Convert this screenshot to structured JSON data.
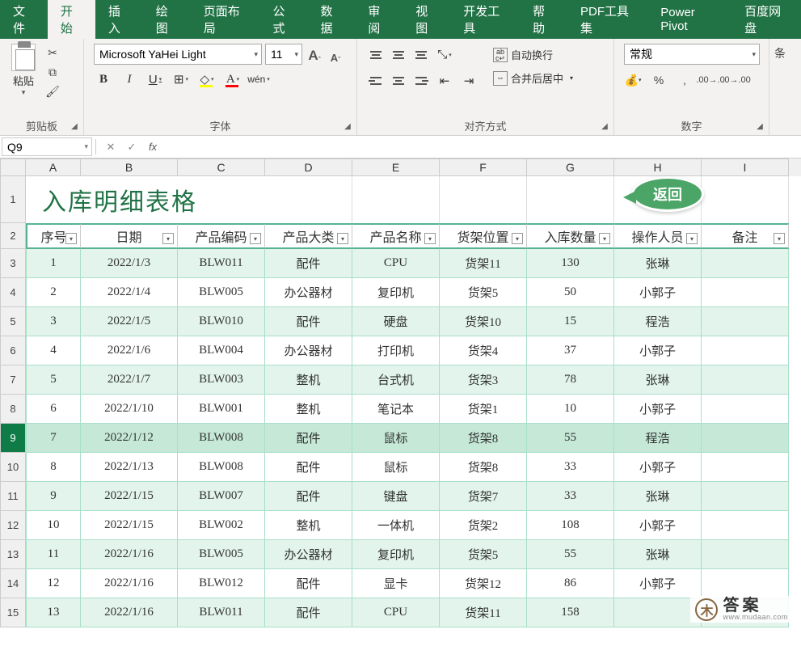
{
  "ribbon": {
    "tabs": [
      "文件",
      "开始",
      "插入",
      "绘图",
      "页面布局",
      "公式",
      "数据",
      "审阅",
      "视图",
      "开发工具",
      "帮助",
      "PDF工具集",
      "Power Pivot",
      "百度网盘"
    ],
    "active_tab": 1,
    "clipboard": {
      "paste": "粘贴",
      "label": "剪贴板"
    },
    "font": {
      "label": "字体",
      "name": "Microsoft YaHei Light",
      "size": "11",
      "increase": "A",
      "decrease": "A",
      "bold": "B",
      "italic": "I",
      "underline": "U",
      "wen": "wén"
    },
    "alignment": {
      "label": "对齐方式",
      "wrap": "自动换行",
      "merge": "合并后居中"
    },
    "number": {
      "label": "数字",
      "format": "常规",
      "percent": "%",
      "comma": ","
    },
    "edge": "条"
  },
  "namebox": "Q9",
  "formula": "",
  "columns": [
    "A",
    "B",
    "C",
    "D",
    "E",
    "F",
    "G",
    "H",
    "I"
  ],
  "row_numbers": [
    1,
    2,
    3,
    4,
    5,
    6,
    7,
    8,
    9,
    10,
    11,
    12,
    13,
    14,
    15
  ],
  "selected_row": 9,
  "title": "入库明细表格",
  "return_button": "返回",
  "headers": [
    "序号",
    "日期",
    "产品编码",
    "产品大类",
    "产品名称",
    "货架位置",
    "入库数量",
    "操作人员",
    "备注"
  ],
  "rows": [
    {
      "n": "1",
      "date": "2022/1/3",
      "code": "BLW011",
      "cat": "配件",
      "name": "CPU",
      "shelf": "货架11",
      "qty": "130",
      "op": "张琳",
      "note": ""
    },
    {
      "n": "2",
      "date": "2022/1/4",
      "code": "BLW005",
      "cat": "办公器材",
      "name": "复印机",
      "shelf": "货架5",
      "qty": "50",
      "op": "小郭子",
      "note": ""
    },
    {
      "n": "3",
      "date": "2022/1/5",
      "code": "BLW010",
      "cat": "配件",
      "name": "硬盘",
      "shelf": "货架10",
      "qty": "15",
      "op": "程浩",
      "note": ""
    },
    {
      "n": "4",
      "date": "2022/1/6",
      "code": "BLW004",
      "cat": "办公器材",
      "name": "打印机",
      "shelf": "货架4",
      "qty": "37",
      "op": "小郭子",
      "note": ""
    },
    {
      "n": "5",
      "date": "2022/1/7",
      "code": "BLW003",
      "cat": "整机",
      "name": "台式机",
      "shelf": "货架3",
      "qty": "78",
      "op": "张琳",
      "note": ""
    },
    {
      "n": "6",
      "date": "2022/1/10",
      "code": "BLW001",
      "cat": "整机",
      "name": "笔记本",
      "shelf": "货架1",
      "qty": "10",
      "op": "小郭子",
      "note": ""
    },
    {
      "n": "7",
      "date": "2022/1/12",
      "code": "BLW008",
      "cat": "配件",
      "name": "鼠标",
      "shelf": "货架8",
      "qty": "55",
      "op": "程浩",
      "note": ""
    },
    {
      "n": "8",
      "date": "2022/1/13",
      "code": "BLW008",
      "cat": "配件",
      "name": "鼠标",
      "shelf": "货架8",
      "qty": "33",
      "op": "小郭子",
      "note": ""
    },
    {
      "n": "9",
      "date": "2022/1/15",
      "code": "BLW007",
      "cat": "配件",
      "name": "键盘",
      "shelf": "货架7",
      "qty": "33",
      "op": "张琳",
      "note": ""
    },
    {
      "n": "10",
      "date": "2022/1/15",
      "code": "BLW002",
      "cat": "整机",
      "name": "一体机",
      "shelf": "货架2",
      "qty": "108",
      "op": "小郭子",
      "note": ""
    },
    {
      "n": "11",
      "date": "2022/1/16",
      "code": "BLW005",
      "cat": "办公器材",
      "name": "复印机",
      "shelf": "货架5",
      "qty": "55",
      "op": "张琳",
      "note": ""
    },
    {
      "n": "12",
      "date": "2022/1/16",
      "code": "BLW012",
      "cat": "配件",
      "name": "显卡",
      "shelf": "货架12",
      "qty": "86",
      "op": "小郭子",
      "note": ""
    },
    {
      "n": "13",
      "date": "2022/1/16",
      "code": "BLW011",
      "cat": "配件",
      "name": "CPU",
      "shelf": "货架11",
      "qty": "158",
      "op": "",
      "note": ""
    }
  ],
  "watermark": {
    "logo": "木",
    "text": "答案",
    "url": "www.mudaan.com"
  }
}
